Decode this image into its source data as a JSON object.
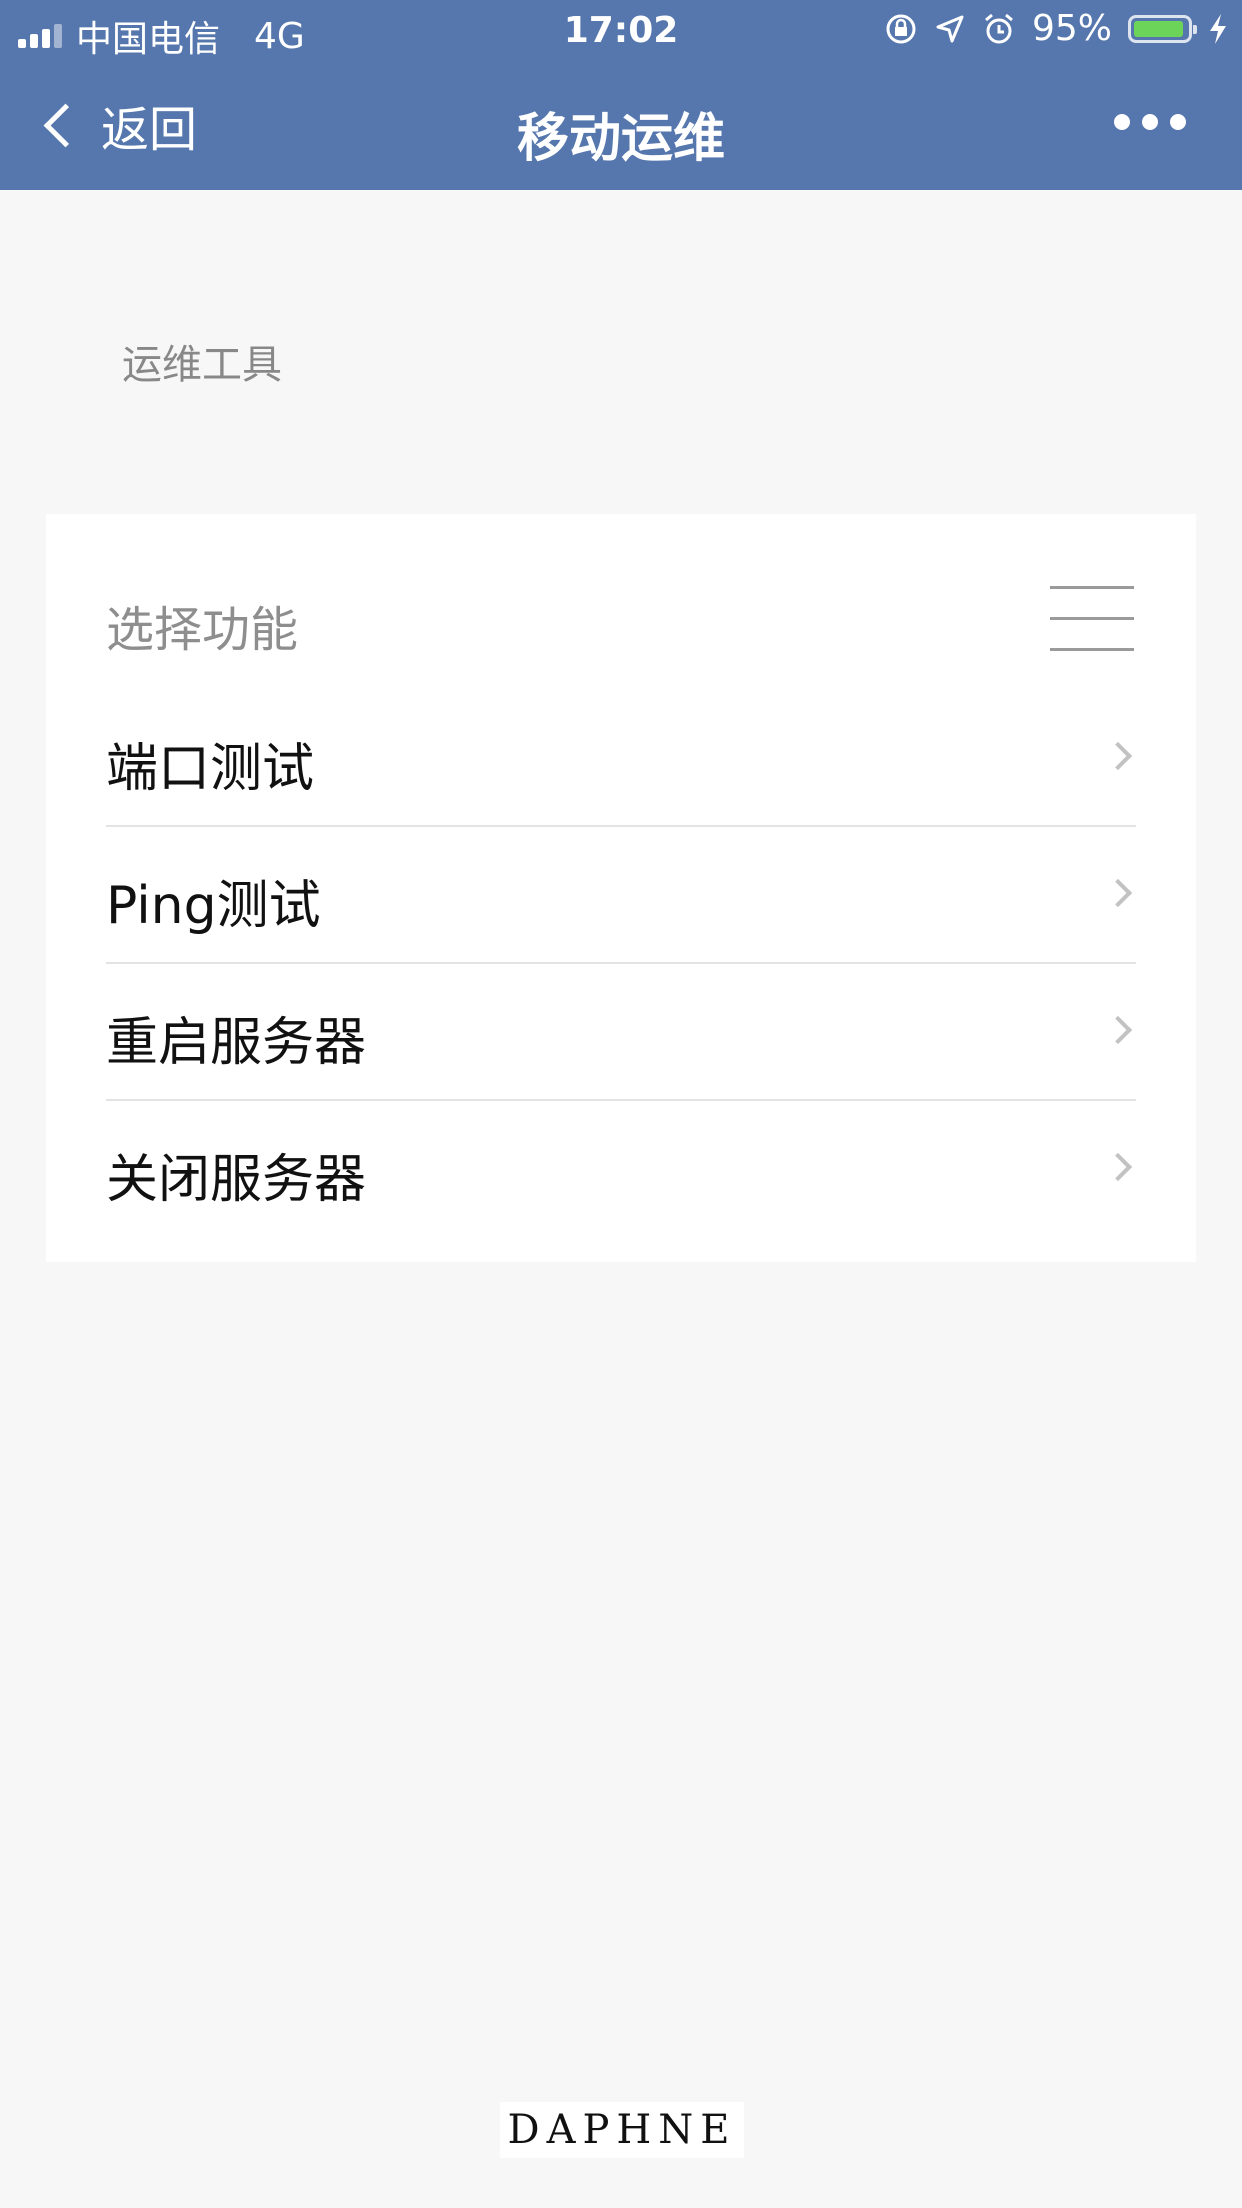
{
  "status_bar": {
    "carrier": "中国电信",
    "network": "4G",
    "time": "17:02",
    "battery_percent": "95%",
    "battery_level": 0.95,
    "icons": [
      "signal-icon",
      "orientation-lock-icon",
      "location-icon",
      "alarm-icon",
      "battery-icon",
      "charging-icon"
    ]
  },
  "nav": {
    "back_label": "返回",
    "title": "移动运维"
  },
  "section": {
    "label": "运维工具"
  },
  "card": {
    "header": "选择功能",
    "items": [
      {
        "label": "端口测试"
      },
      {
        "label": "Ping测试"
      },
      {
        "label": "重启服务器"
      },
      {
        "label": "关闭服务器"
      }
    ]
  },
  "footer": {
    "logo_text": "DAPHNE"
  },
  "colors": {
    "nav_background": "#5677ad",
    "page_background": "#f7f7f7",
    "battery_fill": "#6dd45a"
  }
}
